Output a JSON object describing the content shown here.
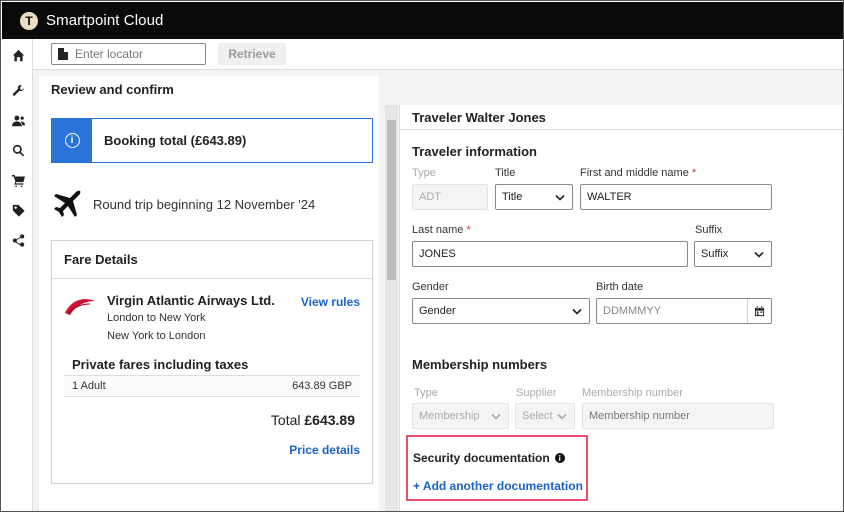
{
  "app": {
    "title": "Smartpoint Cloud",
    "logo_letter": "T"
  },
  "sidebar": {
    "icons": [
      "home-icon",
      "wrench-icon",
      "users-icon",
      "search-icon",
      "cart-icon",
      "tag-icon",
      "share-icon"
    ]
  },
  "locator": {
    "placeholder": "Enter locator",
    "retrieve_label": "Retrieve"
  },
  "review": {
    "title": "Review and confirm",
    "booking_total": "Booking total (£643.89)",
    "trip_summary": "Round trip beginning 12 November '24",
    "fare_details": {
      "title": "Fare Details",
      "airline": "Virgin Atlantic Airways Ltd.",
      "route_out": "London to New York",
      "route_back": "New York to London",
      "view_rules": "View rules",
      "fares_heading": "Private fares including taxes",
      "passenger_label": "1 Adult",
      "passenger_amount": "643.89 GBP",
      "total_label": "Total",
      "total_value": "£643.89",
      "price_details": "Price details"
    }
  },
  "traveler": {
    "header": "Traveler Walter Jones",
    "info_title": "Traveler information",
    "type_label": "Type",
    "type_value": "ADT",
    "title_label": "Title",
    "title_value": "Title",
    "first_name_label": "First and middle name",
    "first_name_value": "WALTER",
    "last_name_label": "Last name",
    "last_name_value": "JONES",
    "suffix_label": "Suffix",
    "suffix_value": "Suffix",
    "gender_label": "Gender",
    "gender_value": "Gender",
    "birth_label": "Birth date",
    "birth_placeholder": "DDMMMYY",
    "required_mark": "*"
  },
  "membership": {
    "title": "Membership numbers",
    "type_label": "Type",
    "type_value": "Membership",
    "supplier_label": "Supplier",
    "supplier_value": "Select",
    "number_label": "Membership number",
    "number_placeholder": "Membership number"
  },
  "security": {
    "title": "Security documentation",
    "info_icon": "i",
    "add_label": "+ Add another documentation"
  },
  "colors": {
    "accent": "#1a63c4",
    "info_blue": "#2a73d9",
    "highlight": "#ef4b6a",
    "topbar": "#0a0a0a"
  }
}
